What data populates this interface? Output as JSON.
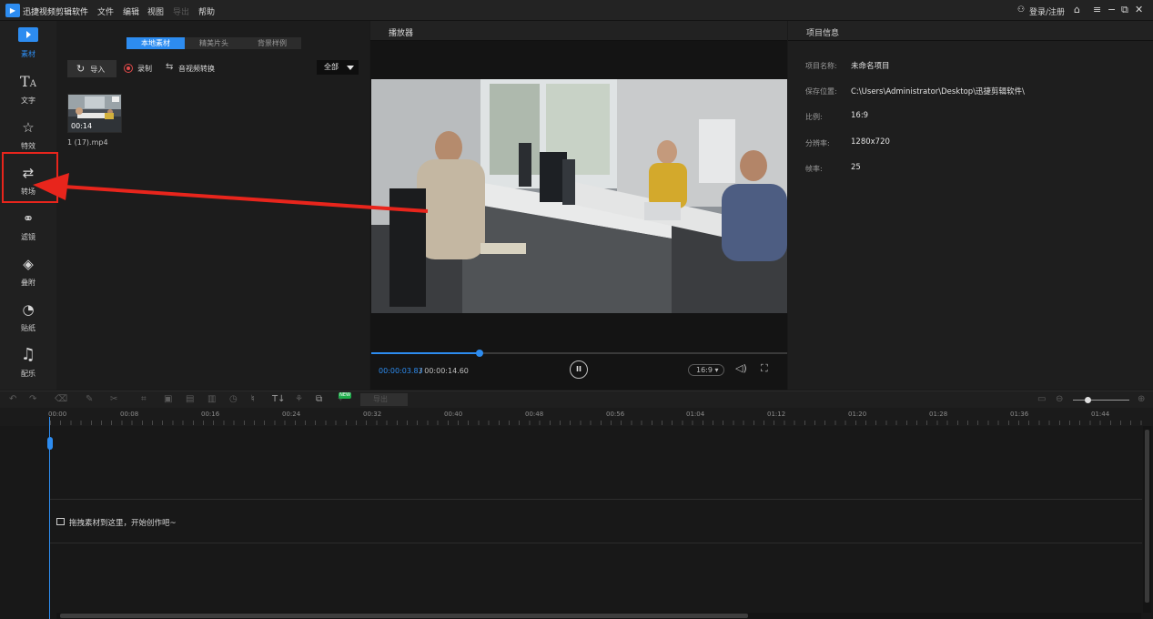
{
  "app": {
    "title": "迅捷视频剪辑软件",
    "menu": [
      "文件",
      "编辑",
      "视图",
      "帮助"
    ],
    "menu_dim": "导出",
    "login": "登录/注册",
    "icons": [
      "user-icon",
      "home-icon",
      "menu-icon",
      "minimize-icon",
      "restore-icon",
      "close-icon"
    ]
  },
  "sidebar": {
    "items": [
      {
        "label": "素材",
        "icon": "media-icon",
        "active": true
      },
      {
        "label": "文字",
        "icon": "text-icon"
      },
      {
        "label": "特效",
        "icon": "effects-icon"
      },
      {
        "label": "转场",
        "icon": "transition-icon"
      },
      {
        "label": "滤镜",
        "icon": "filter-icon"
      },
      {
        "label": "叠附",
        "icon": "overlay-icon"
      },
      {
        "label": "贴纸",
        "icon": "sticker-icon"
      },
      {
        "label": "配乐",
        "icon": "music-icon"
      }
    ]
  },
  "media": {
    "tabs": [
      "本地素材",
      "精美片头",
      "背景样例"
    ],
    "import_label": "导入",
    "record_label": "录制",
    "convert_label": "音视频转换",
    "filter_value": "全部",
    "clip": {
      "duration": "00:14",
      "name": "1 (17).mp4"
    }
  },
  "player": {
    "title": "播放器",
    "time_current": "00:00:03.83",
    "time_total": " / 00:00:14.60",
    "progress": 0.26,
    "ratio": "16:9",
    "pause_label": "II"
  },
  "project": {
    "title": "项目信息",
    "rows": [
      {
        "key": "项目名称:",
        "value": "未命名项目"
      },
      {
        "key": "保存位置:",
        "value": "C:\\Users\\Administrator\\Desktop\\迅捷剪辑软件\\"
      },
      {
        "key": "比例:",
        "value": "16:9"
      },
      {
        "key": "分辨率:",
        "value": "1280x720"
      },
      {
        "key": "帧率:",
        "value": "25"
      }
    ]
  },
  "toolbar": {
    "new_badge": "NEW",
    "export_label": "导出"
  },
  "timeline": {
    "ticks": [
      "00:00",
      "00:08",
      "00:16",
      "00:24",
      "00:32",
      "00:40",
      "00:48",
      "00:56",
      "01:04",
      "01:12",
      "01:20",
      "01:28",
      "01:36",
      "01:44"
    ],
    "drop_hint": "拖拽素材到这里，开始创作吧~"
  },
  "colors": {
    "accent": "#2d8cf0",
    "annotation": "#e8251c"
  }
}
